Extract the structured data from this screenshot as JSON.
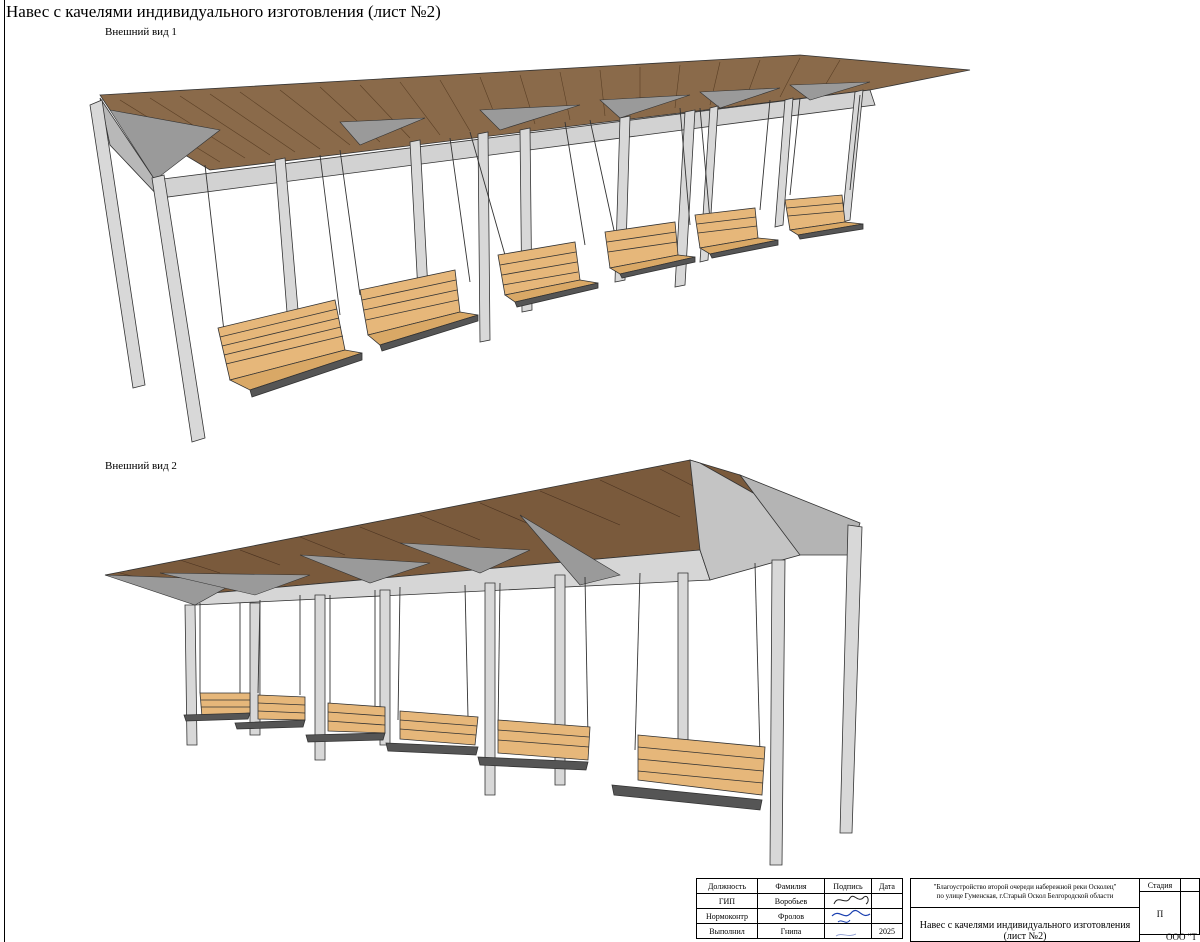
{
  "sheet": {
    "title": "Навес с качелями индивидуального изготовления (лист №2)"
  },
  "views": [
    {
      "label": "Внешний вид 1"
    },
    {
      "label": "Внешний вид 2"
    }
  ],
  "title_block": {
    "headers": {
      "position": "Должность",
      "surname": "Фамилия",
      "signature": "Подпись",
      "date": "Дата"
    },
    "rows": [
      {
        "position": "ГИП",
        "surname": "Воробьев",
        "date": ""
      },
      {
        "position": "Нормоконтр",
        "surname": "Фролов",
        "date": ""
      },
      {
        "position": "Выполнил",
        "surname": "Гнипа",
        "date": "2025"
      }
    ],
    "project_line1": "\"Благоустройство второй очереди набережной реки Осколец\"",
    "project_line2": "по улице Гуменская, г.Старый Оскол Белгородской области",
    "sheet_name_line1": "Навес с качелями индивидуального изготовления",
    "sheet_name_line2": "(лист №2)",
    "stage_label": "Стадия",
    "stage_value": "П",
    "org": "ООО \"Т"
  },
  "colors": {
    "frame_gray": "#c9c9c9",
    "frame_dark": "#8e8e8e",
    "roof_wood": "#7a5a3c",
    "seat_wood": "#e6b77a",
    "seat_dark": "#5a5a5a"
  }
}
